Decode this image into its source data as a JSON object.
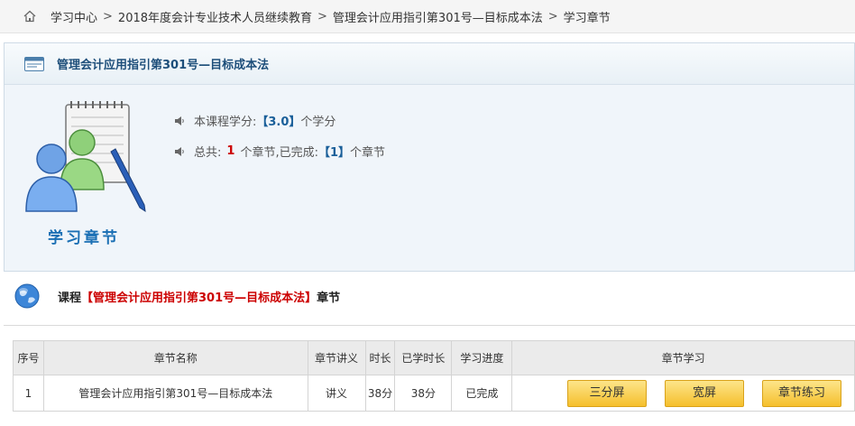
{
  "breadcrumb": {
    "items": [
      "学习中心",
      "2018年度会计专业技术人员继续教育",
      "管理会计应用指引第301号—目标成本法",
      "学习章节"
    ]
  },
  "panel": {
    "title": "管理会计应用指引第301号—目标成本法",
    "illustration_title": "学习章节",
    "credit_prefix": "本课程学分:",
    "credit_value": "【3.0】",
    "credit_suffix": "个学分",
    "total_prefix": "总共:",
    "total_chapters": "1",
    "total_middle": "个章节,已完成:",
    "completed_value": "【1】",
    "completed_suffix": "个章节"
  },
  "course": {
    "label": "课程",
    "name": "【管理会计应用指引第301号—目标成本法】",
    "suffix": "章节"
  },
  "table": {
    "headers": [
      "序号",
      "章节名称",
      "章节讲义",
      "时长",
      "已学时长",
      "学习进度",
      "章节学习"
    ],
    "rows": [
      {
        "index": "1",
        "name": "管理会计应用指引第301号—目标成本法",
        "handout": "讲义",
        "duration": "38分",
        "studied": "38分",
        "progress": "已完成",
        "btn_split": "三分屏",
        "btn_wide": "宽屏",
        "btn_practice": "章节练习"
      }
    ]
  },
  "colors": {
    "accent_blue": "#1a5f99",
    "highlight_red": "#cc0000",
    "button_yellow": "#f5bf2c"
  },
  "icons": [
    "home-icon",
    "card-icon",
    "speaker-icon",
    "globe-icon",
    "study-illustration"
  ]
}
